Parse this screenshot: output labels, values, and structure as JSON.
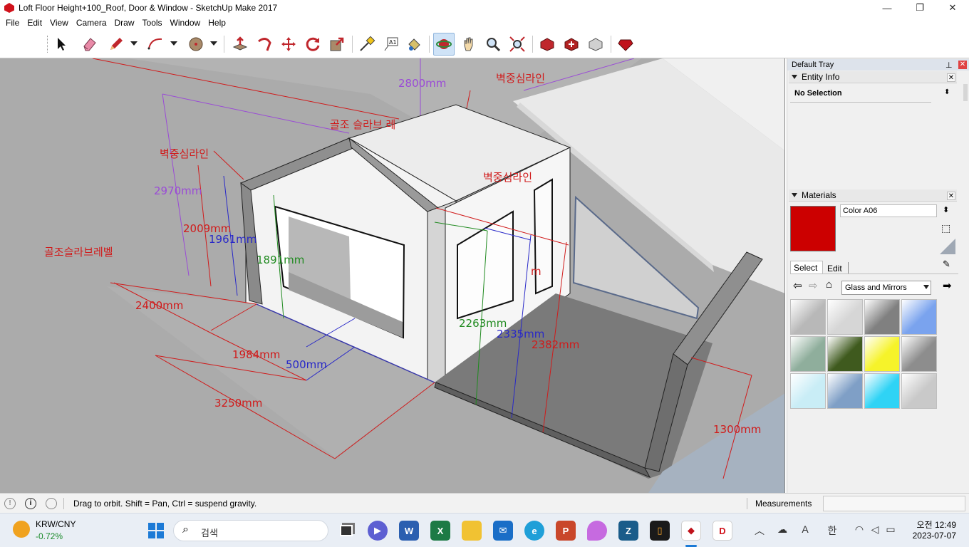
{
  "window": {
    "title": "Loft Floor Height+100_Roof, Door & Window - SketchUp Make 2017",
    "minimize_glyph": "—",
    "restore_glyph": "❐",
    "close_glyph": "✕"
  },
  "menu": [
    "File",
    "Edit",
    "View",
    "Camera",
    "Draw",
    "Tools",
    "Window",
    "Help"
  ],
  "toolbar": {
    "tools": [
      "select-tool",
      "eraser-tool",
      "pencil-tool",
      "arc-tool",
      "shapes-tool",
      "push-pull-tool",
      "follow-me-tool",
      "move-tool",
      "rotate-tool",
      "scale-tool",
      "tape-measure-tool",
      "text-tool",
      "paint-bucket-tool",
      "orbit-tool",
      "pan-tool",
      "zoom-tool",
      "zoom-extents-tool",
      "3d-warehouse",
      "extension-warehouse",
      "share-model",
      "extension-manager"
    ],
    "active": "orbit-tool"
  },
  "model": {
    "labels": {
      "center_line_top": "벽중심라인",
      "center_line_left": "벽중심라인",
      "center_line_mid": "벽중심라인",
      "slab_top": "골조 슬라브 레",
      "slab_left": "골조슬라브레벨"
    },
    "dimensions": {
      "d2800": "2800mm",
      "d2970": "2970mm",
      "d2009": "2009mm",
      "d1961": "1961mm",
      "d1891": "1891mm",
      "d2400": "2400mm",
      "d1984": "1984mm",
      "d500": "500mm",
      "d3250": "3250mm",
      "d2263": "2263mm",
      "d2335": "2335mm",
      "d2382": "2382mm",
      "d1300": "1300mm",
      "d_partial": "m"
    }
  },
  "tray": {
    "title": "Default Tray",
    "entity_info": {
      "header": "Entity Info",
      "selection": "No Selection"
    },
    "materials": {
      "header": "Materials",
      "current_name": "Color A06",
      "current_color": "#cc0000",
      "tabs": [
        "Select",
        "Edit"
      ],
      "active_tab": "Select",
      "collection": "Glass and Mirrors",
      "swatches": [
        {
          "name": "mirror-gray",
          "color": "#b8b8b8"
        },
        {
          "name": "mirror-light",
          "color": "#d6d6d6"
        },
        {
          "name": "glass-block",
          "color": "#808080"
        },
        {
          "name": "glass-blue",
          "color": "#7aa3ee"
        },
        {
          "name": "glass-striped",
          "color": "#8fae9c"
        },
        {
          "name": "glass-green",
          "color": "#3f5a1e"
        },
        {
          "name": "glass-yellow",
          "color": "#f6f32a"
        },
        {
          "name": "glass-gray",
          "color": "#8d8d8d"
        },
        {
          "name": "glass-cyan-pattern",
          "color": "#c9edf6"
        },
        {
          "name": "glass-sky",
          "color": "#7f9fc6"
        },
        {
          "name": "glass-cyan",
          "color": "#2fd3f5"
        },
        {
          "name": "glass-frosted",
          "color": "#c9c9c9"
        }
      ]
    }
  },
  "status": {
    "hint": "Drag to orbit. Shift = Pan, Ctrl = suspend gravity.",
    "measurements_label": "Measurements",
    "measurements_value": ""
  },
  "taskbar": {
    "ticker_name": "KRW/CNY",
    "ticker_change": "-0.72%",
    "search_placeholder": "검색",
    "apps": [
      "start",
      "search",
      "task-view",
      "zoom",
      "word",
      "excel",
      "file-explorer",
      "mail",
      "edge",
      "powerpoint",
      "paint",
      "app-zeta",
      "sketchbook",
      "sketchup",
      "dwg-viewer"
    ],
    "ime_a": "A",
    "ime_han": "한",
    "time": "오전 12:49",
    "date": "2023-07-07"
  }
}
